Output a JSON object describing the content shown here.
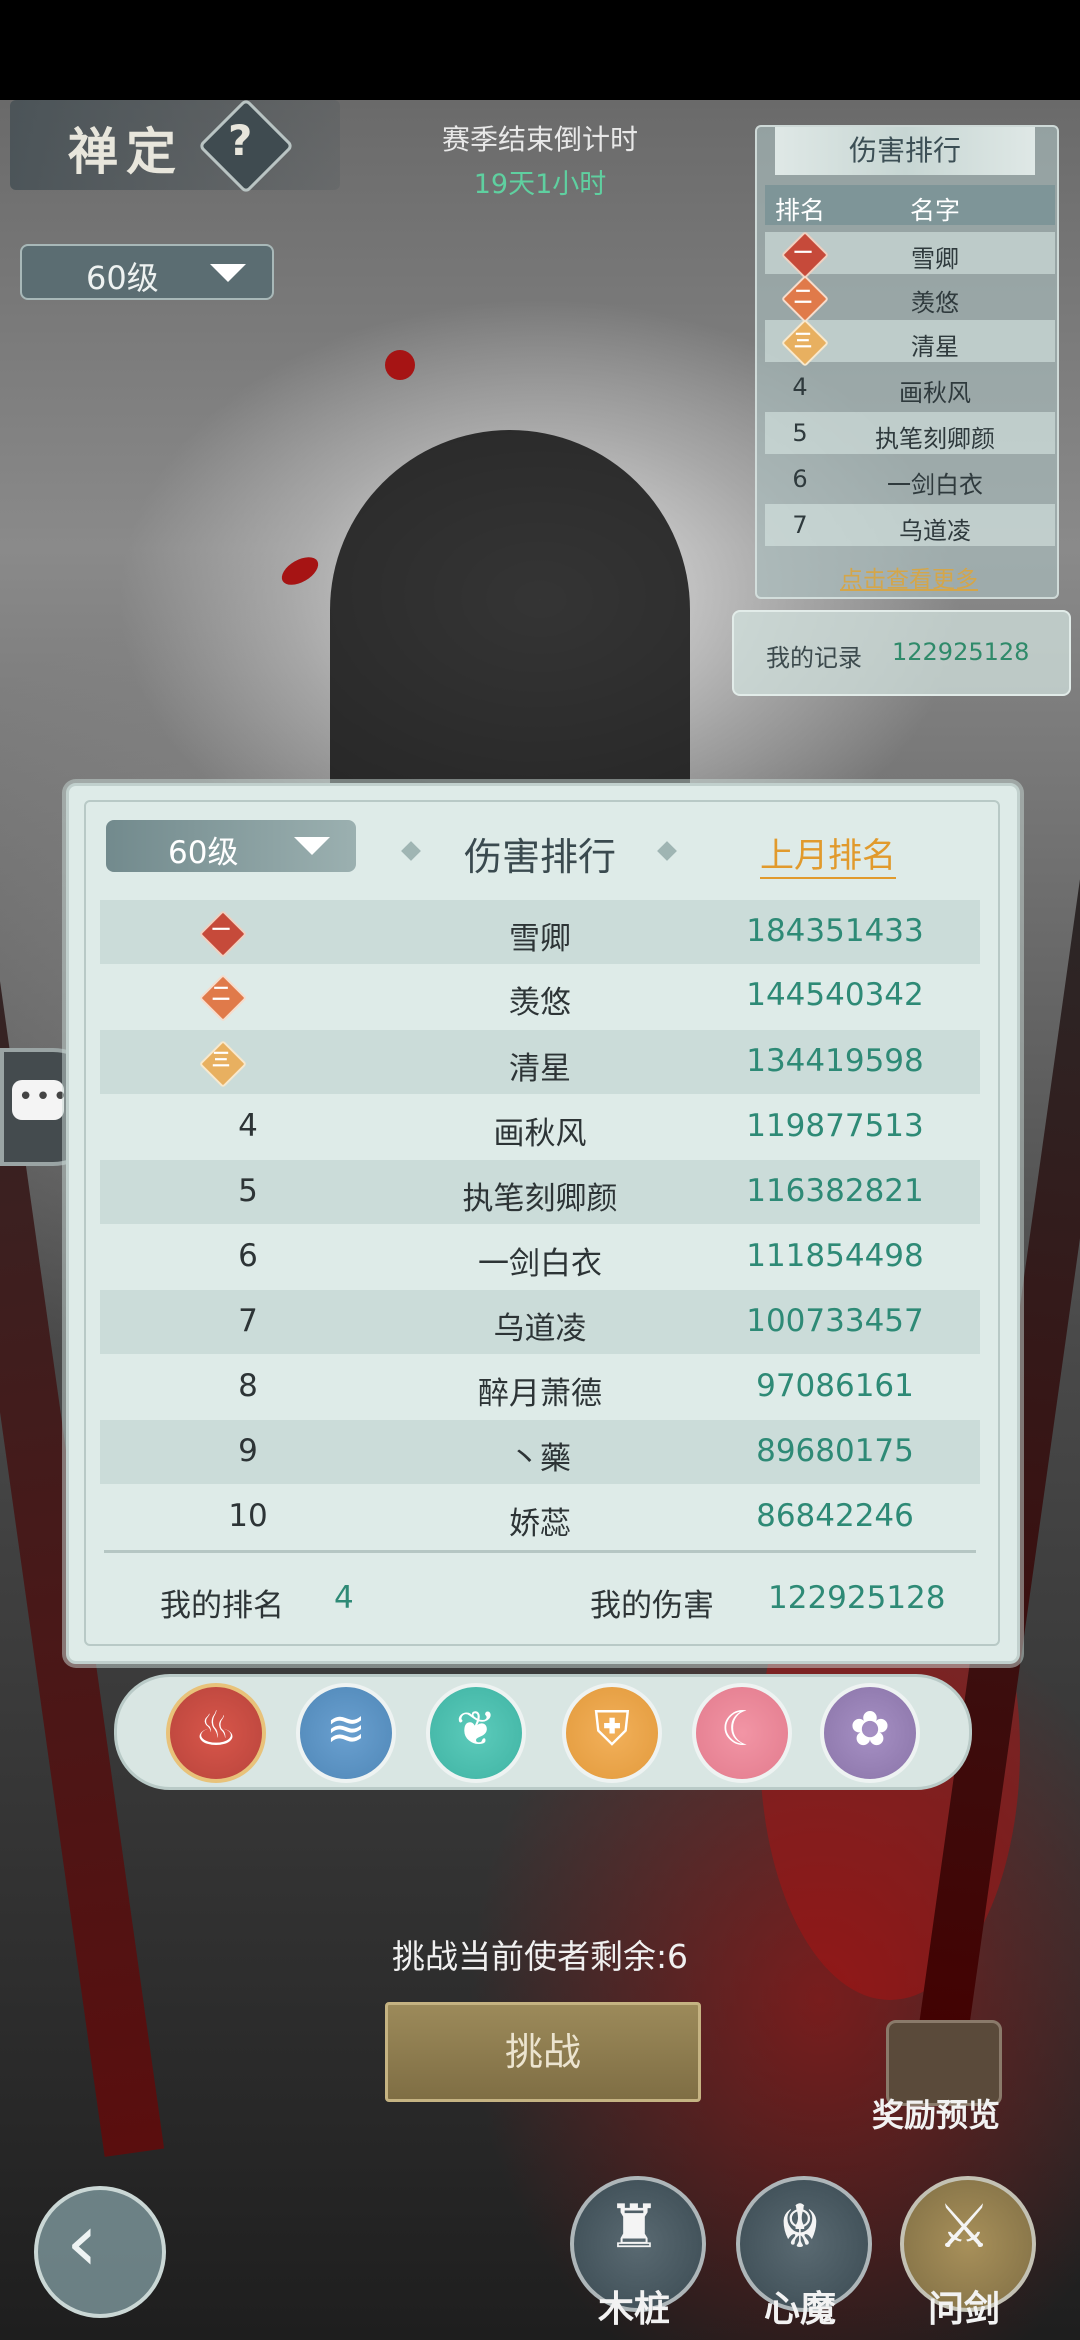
{
  "header": {
    "title": "禅定",
    "help_symbol": "?",
    "level_select": "60级",
    "season_label": "赛季结束倒计时",
    "season_time": "19天1小时"
  },
  "mini_ranking": {
    "title": "伤害排行",
    "col_rank": "排名",
    "col_name": "名字",
    "rows": [
      {
        "rank": "一",
        "name": "雪卿",
        "medal": "gold"
      },
      {
        "rank": "二",
        "name": "羡悠",
        "medal": "silver"
      },
      {
        "rank": "三",
        "name": "清星",
        "medal": "bronze"
      },
      {
        "rank": "4",
        "name": "画秋风"
      },
      {
        "rank": "5",
        "name": "执笔刻卿颜"
      },
      {
        "rank": "6",
        "name": "一剑白衣"
      },
      {
        "rank": "7",
        "name": "乌道凌"
      }
    ],
    "more_link": "点击查看更多",
    "my_record_label": "我的记录",
    "my_record_value": "122925128"
  },
  "panel": {
    "level_select": "60级",
    "title": "伤害排行",
    "last_month_link": "上月排名",
    "rows": [
      {
        "rank": "一",
        "name": "雪卿",
        "score": "184351433",
        "medal": "gold"
      },
      {
        "rank": "二",
        "name": "羡悠",
        "score": "144540342",
        "medal": "silver"
      },
      {
        "rank": "三",
        "name": "清星",
        "score": "134419598",
        "medal": "bronze"
      },
      {
        "rank": "4",
        "name": "画秋风",
        "score": "119877513"
      },
      {
        "rank": "5",
        "name": "执笔刻卿颜",
        "score": "116382821"
      },
      {
        "rank": "6",
        "name": "一剑白衣",
        "score": "111854498"
      },
      {
        "rank": "7",
        "name": "乌道凌",
        "score": "100733457"
      },
      {
        "rank": "8",
        "name": "醉月萧德",
        "score": "97086161"
      },
      {
        "rank": "9",
        "name": "丶藥",
        "score": "89680175"
      },
      {
        "rank": "10",
        "name": "娇蕊",
        "score": "86842246"
      }
    ],
    "my_rank_label": "我的排名",
    "my_rank_value": "4",
    "my_damage_label": "我的伤害",
    "my_damage_value": "122925128"
  },
  "elements": [
    {
      "name": "fire",
      "color": "#b8443c",
      "ring": "#e8c27a"
    },
    {
      "name": "water",
      "color": "#4f87b7",
      "ring": "#eef3f2"
    },
    {
      "name": "wind",
      "color": "#3fb3a3",
      "ring": "#eef3f2"
    },
    {
      "name": "earth",
      "color": "#e29a3c",
      "ring": "#eef3f2"
    },
    {
      "name": "moon",
      "color": "#e27b8d",
      "ring": "#eef3f2"
    },
    {
      "name": "mist",
      "color": "#8a74a8",
      "ring": "#eef3f2"
    }
  ],
  "challenge": {
    "remaining": "挑战当前使者剩余:6",
    "button": "挑战"
  },
  "reward_preview": "奖励预览",
  "bottom_nav": {
    "dummy": "木桩",
    "demon": "心魔",
    "ask_sword": "问剑"
  }
}
